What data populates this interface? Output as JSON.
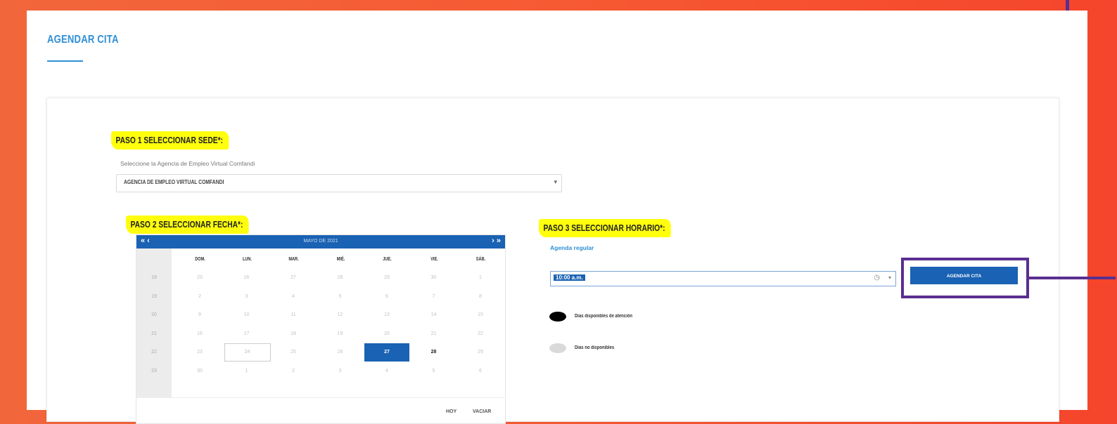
{
  "page": {
    "title": "AGENDAR CITA"
  },
  "step1": {
    "title": "PASO 1 SELECCIONAR SEDE*:",
    "hint": "Seleccione la Agencia de Empleo Virtual Comfandi",
    "selected": "AGENCIA DE EMPLEO VIRTUAL COMFANDI"
  },
  "step2": {
    "title": "PASO 2 SELECCIONAR FECHA*:",
    "calendar": {
      "month_label": "MAYO DE 2021",
      "prev": "« ‹",
      "next": "› »",
      "day_headers": [
        "DOM.",
        "LUN.",
        "MAR.",
        "MIÉ.",
        "JUE.",
        "VIE.",
        "SÁB."
      ],
      "weeks": [
        {
          "num": "18",
          "days": [
            "25",
            "26",
            "27",
            "28",
            "29",
            "30",
            "1"
          ]
        },
        {
          "num": "19",
          "days": [
            "2",
            "3",
            "4",
            "5",
            "6",
            "7",
            "8"
          ]
        },
        {
          "num": "20",
          "days": [
            "9",
            "10",
            "11",
            "12",
            "13",
            "14",
            "15"
          ]
        },
        {
          "num": "21",
          "days": [
            "16",
            "17",
            "18",
            "19",
            "20",
            "21",
            "22"
          ]
        },
        {
          "num": "22",
          "days": [
            "23",
            "24",
            "25",
            "26",
            "27",
            "28",
            "29"
          ]
        },
        {
          "num": "23",
          "days": [
            "30",
            "1",
            "2",
            "3",
            "4",
            "5",
            "6"
          ]
        }
      ],
      "today_label": "HOY",
      "clear_label": "VACIAR"
    }
  },
  "step3": {
    "title": "PASO 3 SELECCIONAR HORARIO*:",
    "subheading": "Agenda regular",
    "time_value": "10:00 a.m.",
    "button_label": "AGENDAR CITA",
    "legend_available": "Días disponibles de atención",
    "legend_unavailable": "Días no disponibles"
  },
  "colors": {
    "primary": "#1a62b3",
    "highlight": "#ffff00",
    "annotation": "#5a2e91"
  }
}
